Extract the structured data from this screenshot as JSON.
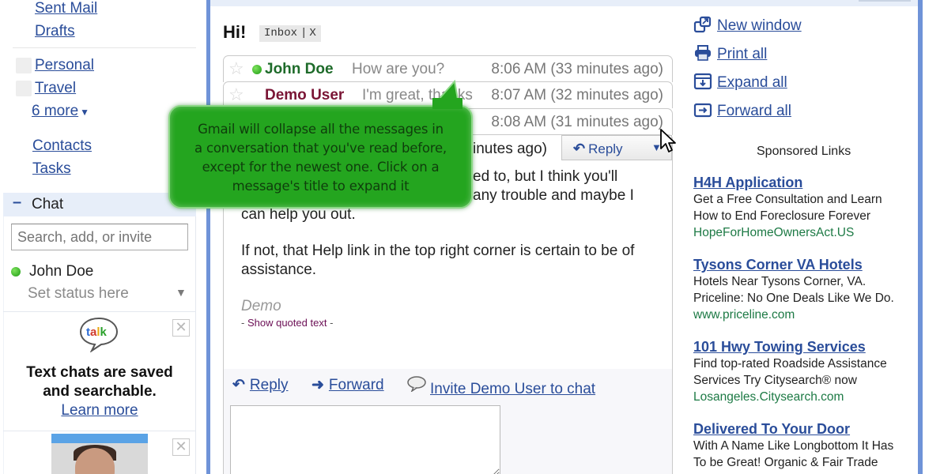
{
  "left_nav": {
    "links": [
      {
        "label": "Sent Mail"
      },
      {
        "label": "Drafts"
      }
    ],
    "labels": [
      {
        "label": "Personal"
      },
      {
        "label": "Travel"
      }
    ],
    "more_label": "6 more",
    "more_arrow": "▼",
    "contacts_label": "Contacts",
    "tasks_label": "Tasks"
  },
  "chat": {
    "header_toggle": "–",
    "header_title": "Chat",
    "search_placeholder": "Search, add, or invite",
    "me": {
      "name": "John Doe",
      "status_placeholder": "Set status here",
      "status_arrow": "▼",
      "presence_color": "#2aa31f"
    },
    "talk_logo_text": "talk",
    "promo_line1": "Text chats are saved",
    "promo_line2": "and searchable.",
    "learn_more": "Learn more",
    "close_glyph": "✕"
  },
  "conversation": {
    "subject": "Hi!",
    "label_chip": "Inbox",
    "label_remove": "X",
    "label_separator": "|",
    "collapsed_messages": [
      {
        "sender": "John Doe",
        "sender_color": "#1e6b2a",
        "online": true,
        "snippet": "How are you?",
        "time": "8:06 AM (33 minutes ago)"
      },
      {
        "sender": "Demo User",
        "sender_color": "#7a1535",
        "online": false,
        "snippet": "I'm great, thanks",
        "time": "8:07 AM (32 minutes ago)"
      },
      {
        "sender": "",
        "sender_color": "#1e6b2a",
        "online": false,
        "snippet": "",
        "time": "8:08 AM (31 minutes ago)"
      }
    ],
    "expanded": {
      "time_partial": "inutes ago)",
      "reply_button": "Reply",
      "reply_more_arrow": "▼",
      "body_lines": [
        "ed to, but I think you'll",
        "any trouble and maybe I",
        "can help you out.",
        "If not, that Help link in the top right corner is certain to be of",
        "assistance."
      ],
      "signature": "Demo",
      "show_quoted": "Show quoted text",
      "quoted_dash": "-"
    },
    "actions": {
      "reply": "Reply",
      "forward": "Forward",
      "invite": "Invite Demo User to chat"
    }
  },
  "right_column": {
    "actions": [
      {
        "label": "New window",
        "icon": "new-window-icon"
      },
      {
        "label": "Print all",
        "icon": "print-icon"
      },
      {
        "label": "Expand all",
        "icon": "expand-icon"
      },
      {
        "label": "Forward all",
        "icon": "forward-all-icon"
      }
    ],
    "sponsored_title": "Sponsored Links",
    "ads": [
      {
        "title": "H4H Application",
        "lines": [
          "Get a Free Consultation and Learn",
          "How to End Foreclosure Forever"
        ],
        "url": "HopeForHomeOwnersAct.US"
      },
      {
        "title": "Tysons Corner VA Hotels",
        "lines": [
          "Hotels Near Tysons Corner, VA.",
          "Priceline: No One Deals Like We Do."
        ],
        "url": "www.priceline.com"
      },
      {
        "title": "101 Hwy Towing Services",
        "lines": [
          "Find top-rated Roadside Assistance",
          "Services Try Citysearch® now"
        ],
        "url": "Losangeles.Citysearch.com"
      },
      {
        "title": "Delivered To Your Door",
        "lines": [
          "With A Name Like Longbottom It Has",
          "To be Great! Organic & Fair Trade"
        ],
        "url": ""
      }
    ]
  },
  "tooltip": {
    "lines": [
      "Gmail will collapse all the messages in",
      "a conversation that you've read before,",
      "except for the newest one. Click on a",
      "message's title to expand it"
    ],
    "color": "#24a51f"
  },
  "colors": {
    "link": "#2a4d9a",
    "frame": "#6f93d8",
    "ad_url": "#1d7a45"
  }
}
